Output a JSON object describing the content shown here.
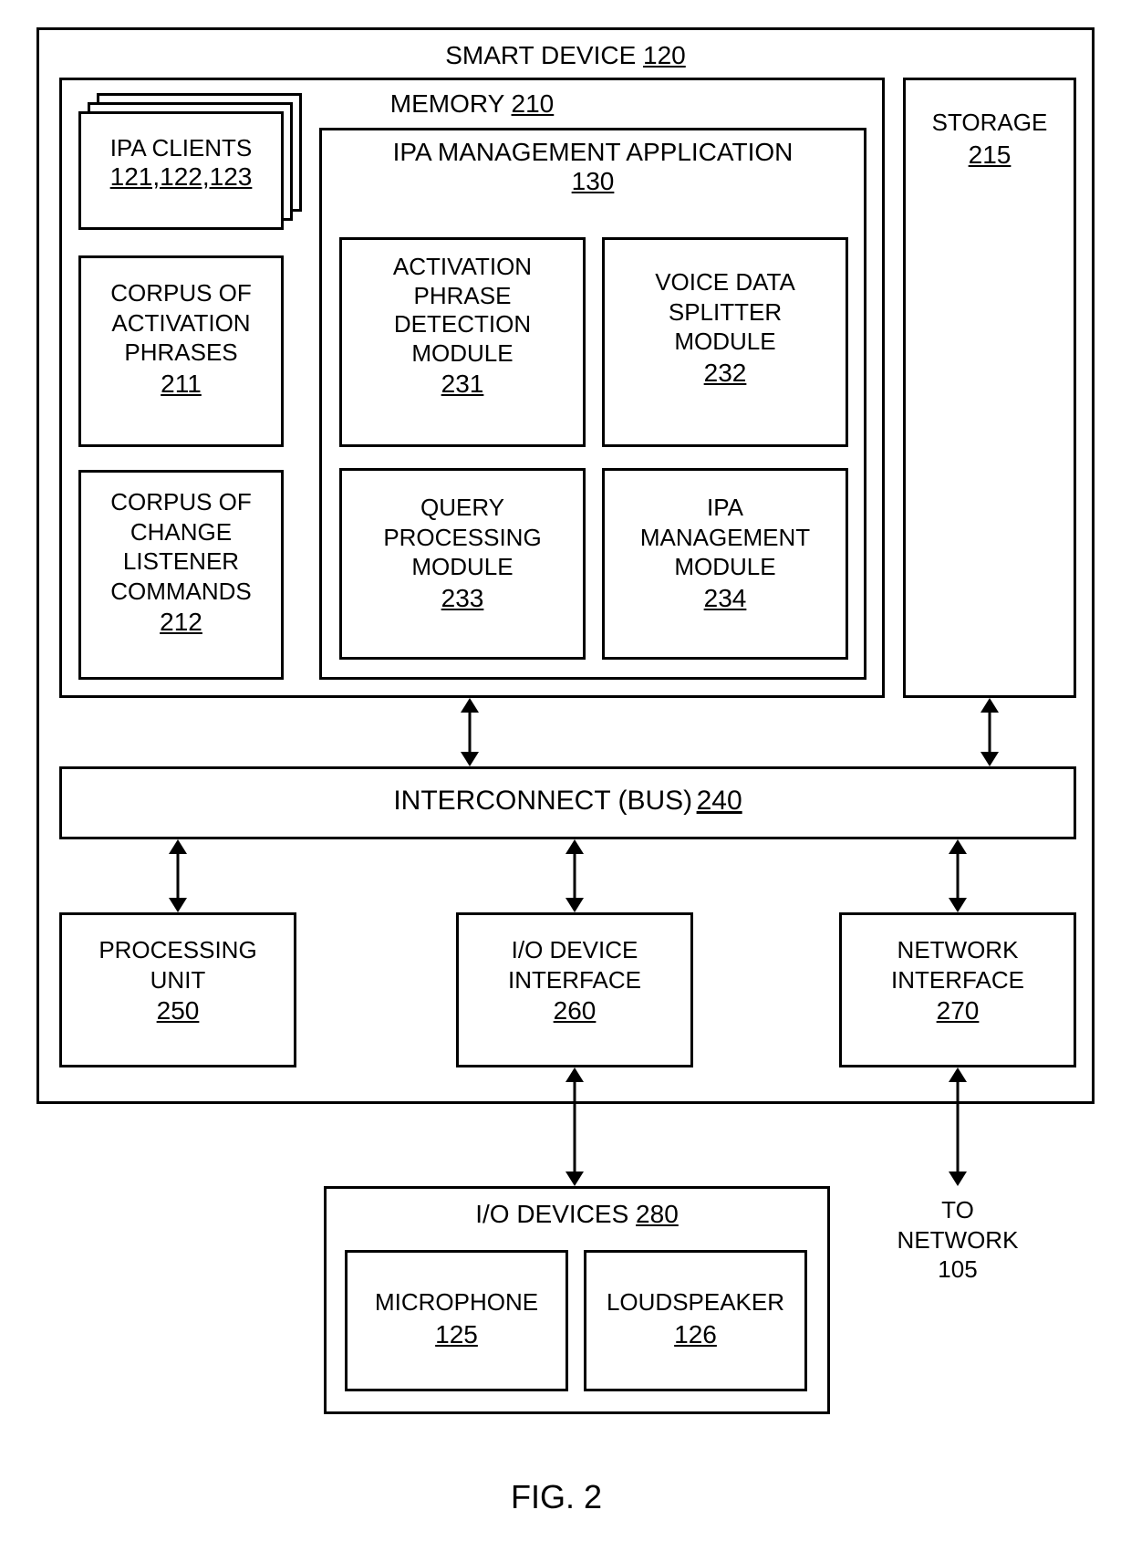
{
  "smart_device": {
    "label": "SMART DEVICE",
    "ref": "120"
  },
  "memory": {
    "label": "MEMORY",
    "ref": "210"
  },
  "ipa_clients": {
    "label": "IPA CLIENTS",
    "ref": "121,122,123"
  },
  "corpus_activation": {
    "line1": "CORPUS OF",
    "line2": "ACTIVATION",
    "line3": "PHRASES",
    "ref": "211"
  },
  "corpus_change": {
    "line1": "CORPUS OF",
    "line2": "CHANGE",
    "line3": "LISTENER",
    "line4": "COMMANDS",
    "ref": "212"
  },
  "ipa_mgmt_app": {
    "label": "IPA MANAGEMENT APPLICATION",
    "ref": "130"
  },
  "apdm": {
    "line1": "ACTIVATION",
    "line2": "PHRASE",
    "line3": "DETECTION",
    "line4": "MODULE",
    "ref": "231"
  },
  "vdsm": {
    "line1": "VOICE DATA",
    "line2": "SPLITTER",
    "line3": "MODULE",
    "ref": "232"
  },
  "qpm": {
    "line1": "QUERY",
    "line2": "PROCESSING",
    "line3": "MODULE",
    "ref": "233"
  },
  "imm": {
    "line1": "IPA",
    "line2": "MANAGEMENT",
    "line3": "MODULE",
    "ref": "234"
  },
  "storage": {
    "label": "STORAGE",
    "ref": "215"
  },
  "bus": {
    "label": "INTERCONNECT (BUS)",
    "ref": "240"
  },
  "cpu": {
    "line1": "PROCESSING",
    "line2": "UNIT",
    "ref": "250"
  },
  "iodi": {
    "line1": "I/O DEVICE",
    "line2": "INTERFACE",
    "ref": "260"
  },
  "neti": {
    "line1": "NETWORK",
    "line2": "INTERFACE",
    "ref": "270"
  },
  "iodev": {
    "label": "I/O DEVICES",
    "ref": "280"
  },
  "mic": {
    "label": "MICROPHONE",
    "ref": "125"
  },
  "spk": {
    "label": "LOUDSPEAKER",
    "ref": "126"
  },
  "to_network": {
    "line1": "TO",
    "line2": "NETWORK",
    "line3": "105"
  },
  "fig": "FIG. 2"
}
